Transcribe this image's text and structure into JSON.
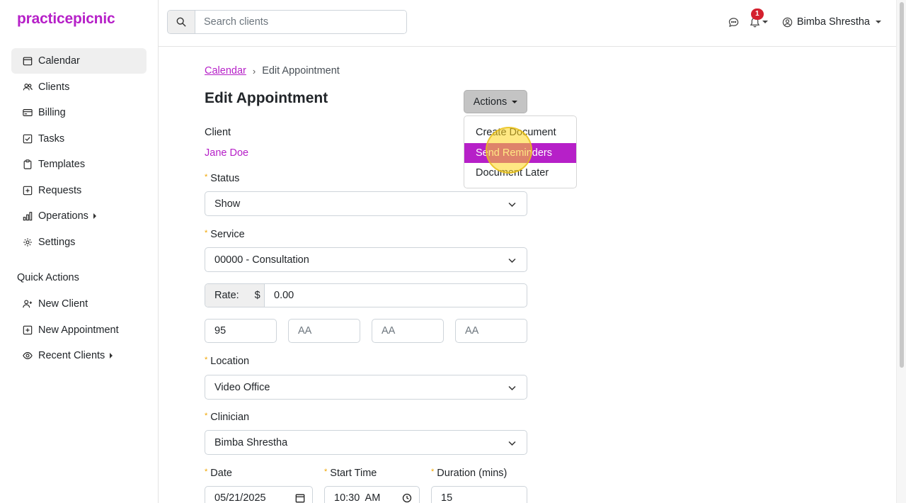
{
  "app": {
    "logo": "practicepicnic"
  },
  "sidebar": {
    "items": [
      {
        "label": "Calendar",
        "icon": "calendar-icon",
        "active": true
      },
      {
        "label": "Clients",
        "icon": "users-icon"
      },
      {
        "label": "Billing",
        "icon": "credit-card-icon"
      },
      {
        "label": "Tasks",
        "icon": "checkbox-icon"
      },
      {
        "label": "Templates",
        "icon": "clipboard-icon"
      },
      {
        "label": "Requests",
        "icon": "plus-square-icon"
      },
      {
        "label": "Operations",
        "icon": "bar-chart-icon",
        "expandable": true
      },
      {
        "label": "Settings",
        "icon": "gear-icon"
      }
    ],
    "quick_actions_title": "Quick Actions",
    "quick_actions": [
      {
        "label": "New Client",
        "icon": "person-add-icon"
      },
      {
        "label": "New Appointment",
        "icon": "calendar-plus-icon"
      },
      {
        "label": "Recent Clients",
        "icon": "eye-icon",
        "expandable": true
      }
    ]
  },
  "header": {
    "search_placeholder": "Search clients",
    "notification_count": "1",
    "user_name": "Bimba Shrestha"
  },
  "breadcrumb": {
    "parent": "Calendar",
    "current": "Edit Appointment"
  },
  "page_title": "Edit Appointment",
  "form": {
    "client_label": "Client",
    "client_name": "Jane Doe",
    "status_label": "Status",
    "status_value": "Show",
    "service_label": "Service",
    "service_value": "00000 - Consultation",
    "rate_label": "Rate:",
    "rate_currency": "$",
    "rate_value": "0.00",
    "modifiers": [
      "95",
      "AA",
      "AA",
      "AA"
    ],
    "location_label": "Location",
    "location_value": "Video Office",
    "clinician_label": "Clinician",
    "clinician_value": "Bimba Shrestha",
    "date_label": "Date",
    "date_value": "05/21/2025",
    "start_time_label": "Start Time",
    "start_time_value": "10:30  AM",
    "duration_label": "Duration (mins)",
    "duration_value": "15"
  },
  "actions": {
    "label": "Actions",
    "menu": [
      "Create Document",
      "Send Reminders",
      "Document Later"
    ],
    "highlighted": "Send Reminders"
  },
  "colors": {
    "brand": "#b620c8",
    "required": "#f0a500",
    "badge": "#d4202e"
  }
}
